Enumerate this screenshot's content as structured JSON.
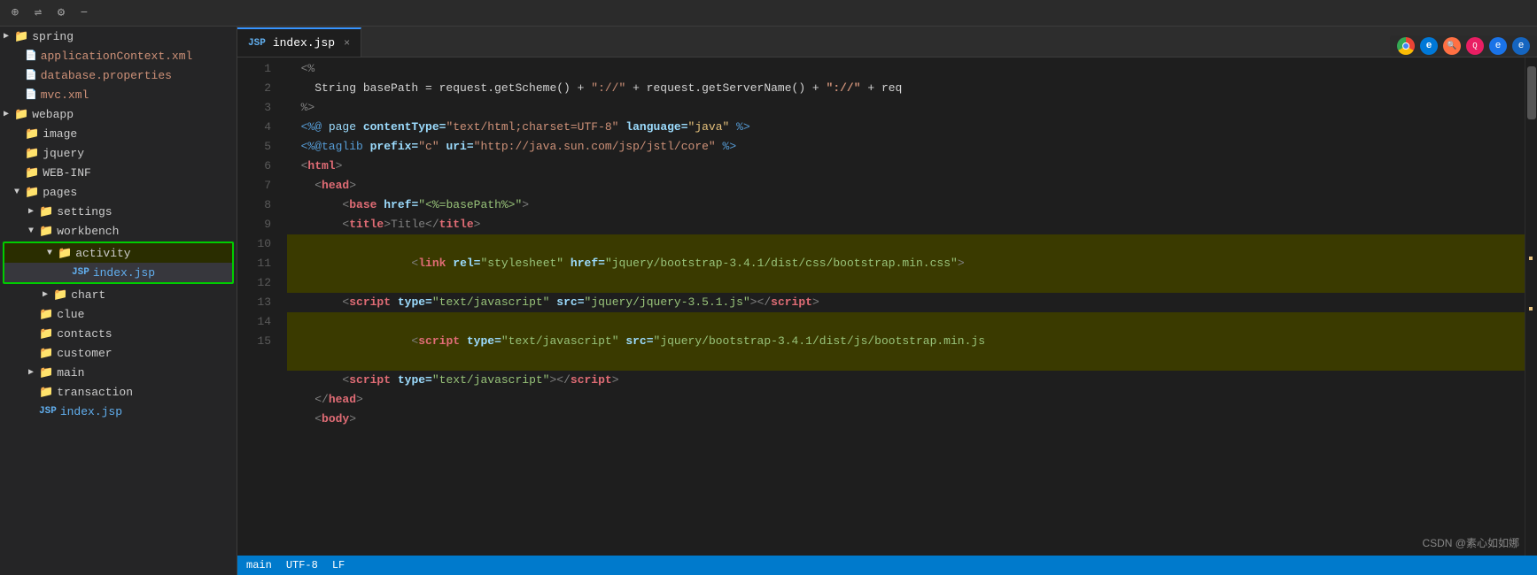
{
  "toolbar": {
    "icons": [
      "⊕",
      "⇌",
      "⚙",
      "−"
    ]
  },
  "sidebar": {
    "items": [
      {
        "id": "spring",
        "label": "spring",
        "type": "folder",
        "indent": 0,
        "arrow": "▶",
        "expanded": false
      },
      {
        "id": "applicationContext",
        "label": "applicationContext.xml",
        "type": "xml",
        "indent": 1
      },
      {
        "id": "database",
        "label": "database.properties",
        "type": "prop",
        "indent": 1
      },
      {
        "id": "mvc",
        "label": "mvc.xml",
        "type": "xml",
        "indent": 1
      },
      {
        "id": "webapp",
        "label": "webapp",
        "type": "folder",
        "indent": 0,
        "arrow": "▶",
        "expanded": true
      },
      {
        "id": "image",
        "label": "image",
        "type": "folder",
        "indent": 1
      },
      {
        "id": "jquery",
        "label": "jquery",
        "type": "folder",
        "indent": 1
      },
      {
        "id": "webinf",
        "label": "WEB-INF",
        "type": "folder",
        "indent": 1
      },
      {
        "id": "pages",
        "label": "pages",
        "type": "folder",
        "indent": 1,
        "arrow": "▼",
        "expanded": true
      },
      {
        "id": "settings",
        "label": "settings",
        "type": "folder",
        "indent": 2,
        "arrow": "▶"
      },
      {
        "id": "workbench",
        "label": "workbench",
        "type": "folder",
        "indent": 2,
        "arrow": "▼",
        "expanded": true
      },
      {
        "id": "activity",
        "label": "activity",
        "type": "folder",
        "indent": 3,
        "arrow": "▼",
        "expanded": true,
        "highlighted": true
      },
      {
        "id": "index-jsp",
        "label": "index.jsp",
        "type": "jsp",
        "indent": 4,
        "highlighted": true,
        "selected": true
      },
      {
        "id": "chart",
        "label": "chart",
        "type": "folder",
        "indent": 3,
        "arrow": "▶"
      },
      {
        "id": "clue",
        "label": "clue",
        "type": "folder",
        "indent": 2
      },
      {
        "id": "contacts",
        "label": "contacts",
        "type": "folder",
        "indent": 2
      },
      {
        "id": "customer",
        "label": "customer",
        "type": "folder",
        "indent": 2
      },
      {
        "id": "main",
        "label": "main",
        "type": "folder",
        "indent": 2,
        "arrow": "▶"
      },
      {
        "id": "transaction",
        "label": "transaction",
        "type": "folder",
        "indent": 2
      },
      {
        "id": "index-jsp2",
        "label": "index.jsp",
        "type": "jsp",
        "indent": 2
      }
    ]
  },
  "tab": {
    "label": "index.jsp",
    "type": "jsp"
  },
  "code": {
    "lines": [
      {
        "num": 1,
        "tokens": [
          {
            "text": "<%",
            "class": "c-gray"
          }
        ]
      },
      {
        "num": 2,
        "tokens": [
          {
            "text": "    String basePath = request.getScheme() + ",
            "class": "c-white"
          },
          {
            "text": "\"://\"",
            "class": "c-orange"
          },
          {
            "text": " + request.getServer",
            "class": "c-white"
          },
          {
            "text": "Name()",
            "class": "c-white"
          },
          {
            "text": " + ",
            "class": "c-white"
          },
          {
            "text": "...",
            "class": "c-white"
          },
          {
            "text": " + req",
            "class": "c-white"
          }
        ]
      },
      {
        "num": 3,
        "tokens": [
          {
            "text": "%>",
            "class": "c-gray"
          }
        ]
      },
      {
        "num": 4,
        "tokens": [
          {
            "text": "<%@ ",
            "class": "c-cyan"
          },
          {
            "text": "page ",
            "class": "c-red"
          },
          {
            "text": "contentType=",
            "class": "c-white"
          },
          {
            "text": "\"text/html;charset=UTF-8\"",
            "class": "c-green"
          },
          {
            "text": " language=",
            "class": "c-white"
          },
          {
            "text": "\"java\"",
            "class": "c-yellow"
          },
          {
            "text": " %>",
            "class": "c-cyan"
          }
        ]
      },
      {
        "num": 5,
        "tokens": [
          {
            "text": "<%@taglib ",
            "class": "c-cyan"
          },
          {
            "text": "prefix=",
            "class": "c-white"
          },
          {
            "text": "\"c\"",
            "class": "c-green"
          },
          {
            "text": " uri=",
            "class": "c-white"
          },
          {
            "text": "\"http://java.sun.com/jsp/jstl/core\"",
            "class": "c-green"
          },
          {
            "text": " %>",
            "class": "c-cyan"
          }
        ]
      },
      {
        "num": 6,
        "tokens": [
          {
            "text": "<",
            "class": "c-gray"
          },
          {
            "text": "html",
            "class": "c-red"
          },
          {
            "text": ">",
            "class": "c-gray"
          }
        ]
      },
      {
        "num": 7,
        "tokens": [
          {
            "text": "    <",
            "class": "c-gray"
          },
          {
            "text": "head",
            "class": "c-red"
          },
          {
            "text": ">",
            "class": "c-gray"
          }
        ]
      },
      {
        "num": 8,
        "tokens": [
          {
            "text": "        <",
            "class": "c-gray"
          },
          {
            "text": "base",
            "class": "c-red"
          },
          {
            "text": " href=",
            "class": "c-white"
          },
          {
            "text": "\"<%=basePath%>\"",
            "class": "c-green"
          },
          {
            "text": ">",
            "class": "c-gray"
          }
        ]
      },
      {
        "num": 9,
        "tokens": [
          {
            "text": "        <",
            "class": "c-gray"
          },
          {
            "text": "title",
            "class": "c-red"
          },
          {
            "text": ">Title</",
            "class": "c-gray"
          },
          {
            "text": "title",
            "class": "c-red"
          },
          {
            "text": ">",
            "class": "c-gray"
          }
        ]
      },
      {
        "num": 10,
        "highlight": true,
        "tokens": [
          {
            "text": "        <",
            "class": "c-gray"
          },
          {
            "text": "link",
            "class": "c-red"
          },
          {
            "text": " rel=",
            "class": "c-white"
          },
          {
            "text": "\"stylesheet\"",
            "class": "c-green"
          },
          {
            "text": " href=",
            "class": "c-white"
          },
          {
            "text": "\"jquery/bootstrap-3.4.1/dist/css/bootstrap.min.css\"",
            "class": "c-green"
          },
          {
            "text": ">",
            "class": "c-gray"
          }
        ]
      },
      {
        "num": 11,
        "tokens": [
          {
            "text": "        <",
            "class": "c-gray"
          },
          {
            "text": "script",
            "class": "c-red"
          },
          {
            "text": " type=",
            "class": "c-white"
          },
          {
            "text": "\"text/javascript\"",
            "class": "c-green"
          },
          {
            "text": " src=",
            "class": "c-white"
          },
          {
            "text": "\"jquery/jquery-3.5.1.js\"",
            "class": "c-green"
          },
          {
            "text": "></",
            "class": "c-gray"
          },
          {
            "text": "script",
            "class": "c-red"
          },
          {
            "text": ">",
            "class": "c-gray"
          }
        ]
      },
      {
        "num": 12,
        "highlight": true,
        "tokens": [
          {
            "text": "        <",
            "class": "c-gray"
          },
          {
            "text": "script",
            "class": "c-red"
          },
          {
            "text": " type=",
            "class": "c-white"
          },
          {
            "text": "\"text/javascript\"",
            "class": "c-green"
          },
          {
            "text": " src=",
            "class": "c-white"
          },
          {
            "text": "\"jquery/bootstrap-3.4.1/dist/js/bootstrap.min.js",
            "class": "c-green"
          }
        ]
      },
      {
        "num": 13,
        "tokens": [
          {
            "text": "        <",
            "class": "c-gray"
          },
          {
            "text": "script",
            "class": "c-red"
          },
          {
            "text": " type=",
            "class": "c-white"
          },
          {
            "text": "\"text/javascript\"",
            "class": "c-green"
          },
          {
            "text": "></",
            "class": "c-gray"
          },
          {
            "text": "script",
            "class": "c-red"
          },
          {
            "text": ">",
            "class": "c-gray"
          }
        ]
      },
      {
        "num": 14,
        "tokens": [
          {
            "text": "    </",
            "class": "c-gray"
          },
          {
            "text": "head",
            "class": "c-red"
          },
          {
            "text": ">",
            "class": "c-gray"
          }
        ]
      },
      {
        "num": 15,
        "tokens": [
          {
            "text": "    <",
            "class": "c-gray"
          },
          {
            "text": "body",
            "class": "c-red"
          },
          {
            "text": ">",
            "class": "c-gray"
          }
        ]
      }
    ]
  },
  "watermark": "CSDN @素心如如娜",
  "bottom_bar": {
    "branch": "main",
    "encoding": "UTF-8",
    "line_ending": "LF"
  }
}
